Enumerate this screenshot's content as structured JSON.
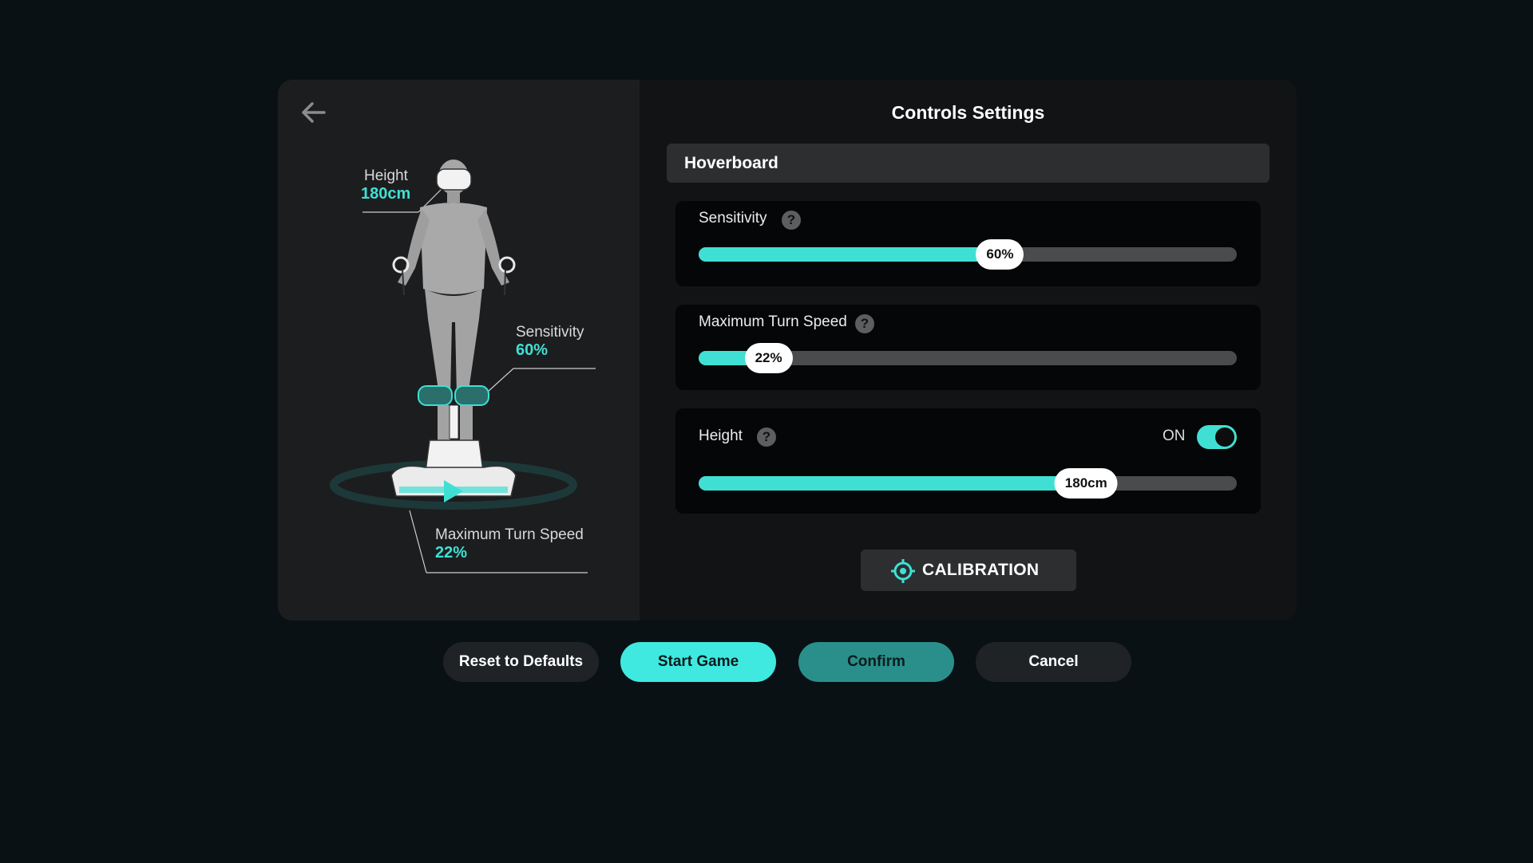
{
  "page": {
    "title": "Controls Settings"
  },
  "figure": {
    "height": {
      "label": "Height",
      "value": "180cm"
    },
    "sensitivity": {
      "label": "Sensitivity",
      "value": "60%"
    },
    "turn_speed": {
      "label": "Maximum Turn Speed",
      "value": "22%"
    }
  },
  "section": {
    "header": "Hoverboard"
  },
  "settings": {
    "sensitivity": {
      "label": "Sensitivity",
      "help": "?",
      "value": "60%",
      "level": 0.56
    },
    "turn_speed": {
      "label": "Maximum Turn Speed",
      "help": "?",
      "value": "22%",
      "level": 0.13
    },
    "height": {
      "label": "Height",
      "help": "?",
      "value": "180cm",
      "level": 0.72,
      "toggle_label": "ON",
      "toggle_on": true
    }
  },
  "calibration": {
    "label": "CALIBRATION",
    "icon": "crosshair-icon"
  },
  "buttons": {
    "reset": "Reset to Defaults",
    "start": "Start Game",
    "confirm": "Confirm",
    "cancel": "Cancel"
  },
  "colors": {
    "accent": "#3fe0d3",
    "background": "#0a1115",
    "panel": "#121314",
    "left_panel": "#1c1d1f"
  },
  "icons": {
    "back": "arrow-left-icon",
    "help": "question-icon"
  }
}
